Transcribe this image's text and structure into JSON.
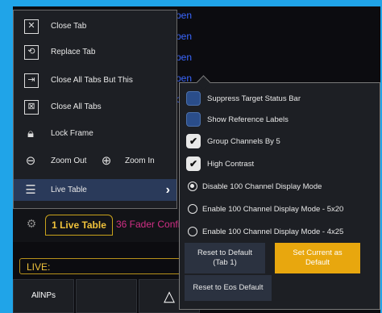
{
  "background": {
    "tabs": [
      "pen",
      "pen",
      "pen",
      "pen",
      "pen"
    ],
    "gear_icon": "gear-icon",
    "live_table_tab": "1 Live Table",
    "fader_tab": "36 Fader Confi",
    "live_label": "LIVE:",
    "cells": [
      "AllNPs",
      "",
      "△",
      ""
    ]
  },
  "menu": {
    "items": [
      {
        "label": "Close Tab",
        "icon": "close-tab-icon"
      },
      {
        "label": "Replace Tab",
        "icon": "replace-tab-icon"
      },
      {
        "label": "Close All Tabs But This",
        "icon": "close-all-but-icon"
      },
      {
        "label": "Close All Tabs",
        "icon": "close-all-icon"
      },
      {
        "label": "Lock Frame",
        "icon": "lock-icon"
      },
      {
        "label": "Zoom Out",
        "icon": "zoom-out-icon"
      },
      {
        "label": "Zoom In",
        "icon": "zoom-in-icon"
      },
      {
        "label": "Live Table",
        "icon": "menu-icon"
      }
    ]
  },
  "submenu": {
    "checkboxes": [
      {
        "label": "Suppress Target Status Bar",
        "checked": false
      },
      {
        "label": "Show Reference Labels",
        "checked": false
      },
      {
        "label": "Group Channels By 5",
        "checked": true
      },
      {
        "label": "High Contrast",
        "checked": true
      }
    ],
    "radios": [
      {
        "label": "Disable 100 Channel Display Mode",
        "selected": true
      },
      {
        "label": "Enable 100 Channel Display Mode - 5x20",
        "selected": false
      },
      {
        "label": "Enable 100 Channel Display Mode - 4x25",
        "selected": false
      }
    ],
    "reset_default": "Reset to Default\n(Tab 1)",
    "set_current": "Set Current as\nDefault",
    "reset_eos": "Reset to Eos Default"
  },
  "colors": {
    "accent": "#e8a70e",
    "desktop": "#20a4e8",
    "checkbox_off": "#2a4d8a"
  }
}
